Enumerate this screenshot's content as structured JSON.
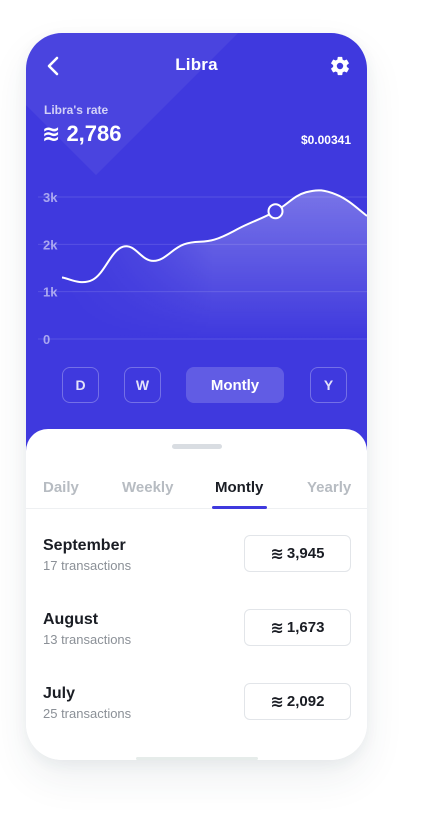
{
  "header": {
    "title": "Libra"
  },
  "rate": {
    "label": "Libra's rate",
    "approx_symbol": "≋",
    "value": "2,786",
    "price": "$0.00341"
  },
  "chart_data": {
    "type": "area",
    "y_tick_labels": [
      "3k",
      "2k",
      "1k",
      "0"
    ],
    "ylim": [
      0,
      3000
    ],
    "grid": true,
    "x": [
      0,
      1,
      2,
      3,
      4,
      5,
      6,
      7,
      8,
      9,
      10
    ],
    "values": [
      1300,
      1250,
      1950,
      1650,
      2000,
      2100,
      2400,
      2700,
      3100,
      3050,
      2600
    ],
    "highlight_index": 7
  },
  "range_buttons": [
    {
      "label": "D",
      "active": false
    },
    {
      "label": "W",
      "active": false
    },
    {
      "label": "Montly",
      "active": true
    },
    {
      "label": "Y",
      "active": false
    }
  ],
  "tabs": [
    {
      "label": "Daily",
      "active": false
    },
    {
      "label": "Weekly",
      "active": false
    },
    {
      "label": "Montly",
      "active": true
    },
    {
      "label": "Yearly",
      "active": false
    }
  ],
  "rows": [
    {
      "month": "September",
      "transactions": "17 transactions",
      "amount": "3,945"
    },
    {
      "month": "August",
      "transactions": "13 transactions",
      "amount": "1,673"
    },
    {
      "month": "July",
      "transactions": "25 transactions",
      "amount": "2,092"
    }
  ],
  "colors": {
    "accent": "#3f39de",
    "text": "#1a1d24",
    "muted": "#b7bcc2"
  }
}
